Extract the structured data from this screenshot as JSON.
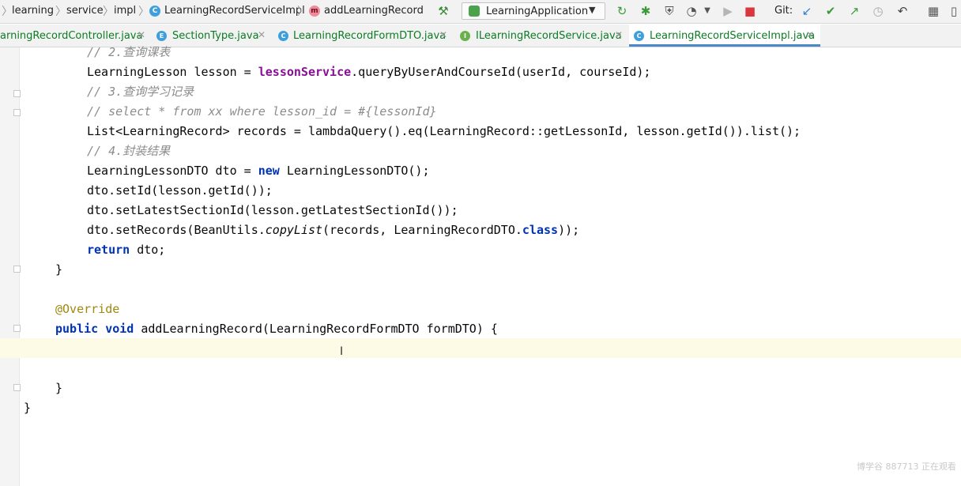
{
  "breadcrumb": {
    "items": [
      "learning",
      "service",
      "impl",
      "LearningRecordServiceImpl",
      "addLearningRecord"
    ]
  },
  "toolbar": {
    "run_config": "LearningApplication",
    "git_label": "Git:"
  },
  "tabs": [
    {
      "label": "arningRecordController.java",
      "icon": "class-icon",
      "active": false
    },
    {
      "label": "SectionType.java",
      "icon_letter": "E",
      "active": false
    },
    {
      "label": "LearningRecordFormDTO.java",
      "icon_letter": "C",
      "active": false
    },
    {
      "label": "ILearningRecordService.java",
      "icon_letter": "I",
      "active": false
    },
    {
      "label": "LearningRecordServiceImpl.java",
      "icon_letter": "C",
      "active": true
    }
  ],
  "icons": {
    "class": "C",
    "method": "m"
  },
  "colors": {
    "keyword": "#0033b3",
    "field": "#871094",
    "comment": "#8c8c8c",
    "annotation": "#9e880d",
    "tab_text": "#0b7c24",
    "active_tab_underline": "#4a88c7",
    "current_line": "#fdfbe6"
  },
  "code": {
    "l1": {
      "comment": "// 2.查询课表"
    },
    "l2": {
      "a": "LearningLesson lesson = ",
      "b": "lessonService",
      "c": ".queryByUserAndCourseId(userId, courseId);"
    },
    "l3": {
      "comment": "// 3.查询学习记录"
    },
    "l4": {
      "comment": "// select * from xx where lesson_id = #{lessonId}"
    },
    "l5": {
      "a": "List<LearningRecord> records = lambdaQuery().eq(LearningRecord::getLessonId, lesson.getId()).list();"
    },
    "l6": {
      "comment": "// 4.封装结果"
    },
    "l7": {
      "a": "LearningLessonDTO dto = ",
      "kw": "new",
      "b": " LearningLessonDTO();"
    },
    "l8": {
      "a": "dto.setId(lesson.getId());"
    },
    "l9": {
      "a": "dto.setLatestSectionId(lesson.getLatestSectionId());"
    },
    "l10": {
      "a": "dto.setRecords(BeanUtils.",
      "it": "copyList",
      "b": "(records, LearningRecordDTO.",
      "kw": "class",
      "c": "));"
    },
    "l11": {
      "kw": "return",
      "a": " dto;"
    },
    "l12": {
      "a": "}"
    },
    "l13": {
      "ann": "@Override"
    },
    "l14": {
      "kw": "public void",
      "a": " addLearningRecord(LearningRecordFormDTO formDTO) {"
    },
    "l15": {
      "a": "}"
    },
    "l16": {
      "a": "}"
    }
  },
  "cursor": "I",
  "watermark": "博学谷 887713 正在观看"
}
